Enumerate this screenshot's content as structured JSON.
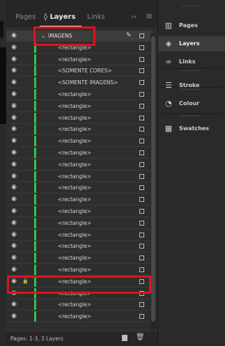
{
  "tabs": {
    "pages": "Pages",
    "layers": "Layers",
    "links": "Links",
    "more": "››",
    "menu": "≡"
  },
  "layers": [
    {
      "label": "IMAGENS",
      "parent": true
    },
    {
      "label": "<rectangle>"
    },
    {
      "label": "<rectangle>"
    },
    {
      "label": "<SOMENTE CORES>"
    },
    {
      "label": "<SOMENTE IMAGENS>"
    },
    {
      "label": "<rectangle>"
    },
    {
      "label": "<rectangle>"
    },
    {
      "label": "<rectangle>"
    },
    {
      "label": "<rectangle>"
    },
    {
      "label": "<rectangle>"
    },
    {
      "label": "<rectangle>"
    },
    {
      "label": "<rectangle>"
    },
    {
      "label": "<rectangle>"
    },
    {
      "label": "<rectangle>"
    },
    {
      "label": "<rectangle>"
    },
    {
      "label": "<rectangle>"
    },
    {
      "label": "<rectangle>"
    },
    {
      "label": "<rectangle>"
    },
    {
      "label": "<rectangle>"
    },
    {
      "label": "<rectangle>"
    },
    {
      "label": "<rectangle>"
    },
    {
      "label": "<rectangle>",
      "locked": true
    },
    {
      "label": "<rectangle>"
    },
    {
      "label": "<rectangle>"
    },
    {
      "label": "<rectangle>"
    }
  ],
  "footer": {
    "status": "Pages: 1-3, 3 Layers"
  },
  "dock": [
    {
      "label": "Pages",
      "icon": "pages-icon",
      "glyph": "▥"
    },
    {
      "label": "Layers",
      "icon": "layers-icon",
      "glyph": "◈",
      "active": true
    },
    {
      "label": "Links",
      "icon": "links-icon",
      "glyph": "∞"
    },
    {
      "label": "Stroke",
      "icon": "stroke-icon",
      "glyph": "☰"
    },
    {
      "label": "Colour",
      "icon": "colour-icon",
      "glyph": "◔"
    },
    {
      "label": "Swatches",
      "icon": "swatches-icon",
      "glyph": "▦"
    }
  ],
  "colors": {
    "layer_color": "#2fc44a",
    "highlight": "#e3101e"
  }
}
